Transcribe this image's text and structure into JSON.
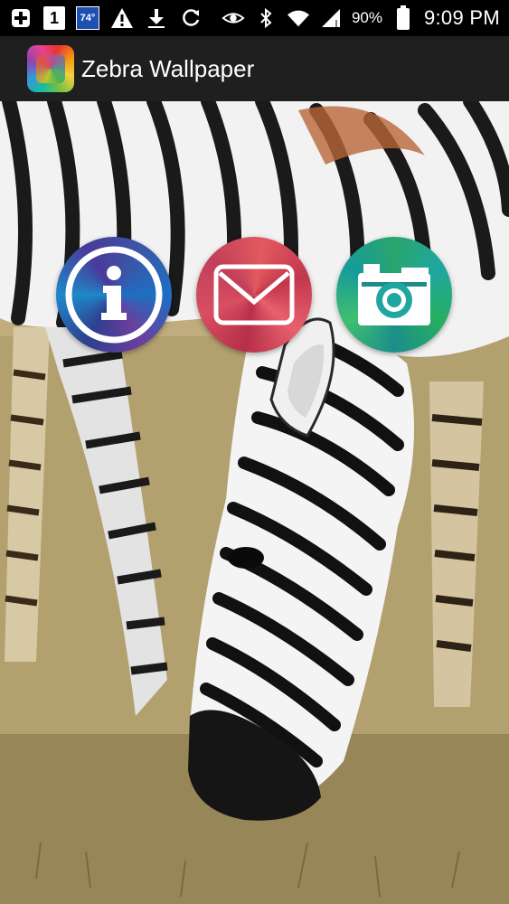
{
  "status_bar": {
    "icons": [
      "add-icon",
      "one-badge-icon",
      "temperature-icon",
      "warning-icon",
      "download-icon",
      "sync-icon",
      "eye-icon",
      "bluetooth-icon",
      "wifi-icon",
      "signal-icon",
      "battery-icon"
    ],
    "temperature": "74°",
    "badge": "1",
    "battery_percent": "90%",
    "time": "9:09 PM"
  },
  "action_bar": {
    "title": "Zebra Wallpaper",
    "icon": "rainbow-app-icon"
  },
  "actions": {
    "info": {
      "icon": "info-icon"
    },
    "mail": {
      "icon": "mail-icon"
    },
    "camera": {
      "icon": "camera-icon"
    }
  },
  "background": {
    "subject": "zebra-grazing"
  },
  "colors": {
    "status_bar_bg": "#000000",
    "action_bar_bg": "#1f1f1f",
    "info_accent": "#3a57a8",
    "mail_accent": "#e25a5f",
    "camera_accent": "#1fa6a0"
  }
}
